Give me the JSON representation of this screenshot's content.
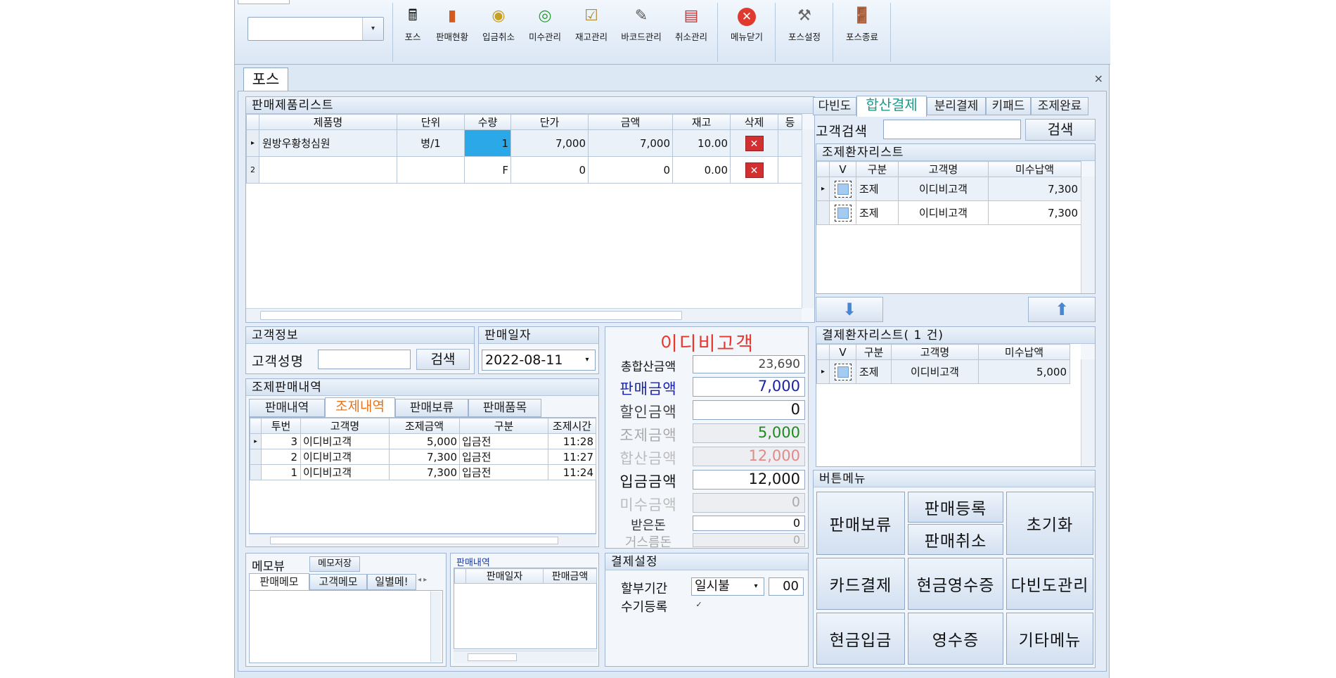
{
  "ribbon": {
    "buttons": [
      {
        "label": "포스",
        "icon": "cash-register-icon"
      },
      {
        "label": "판매현황",
        "icon": "bar-chart-icon"
      },
      {
        "label": "입금취소",
        "icon": "coin-cancel-icon"
      },
      {
        "label": "미수관리",
        "icon": "coins-icon"
      },
      {
        "label": "재고관리",
        "icon": "clipboard-check-icon"
      },
      {
        "label": "바코드관리",
        "icon": "barcode-scanner-icon"
      },
      {
        "label": "취소관리",
        "icon": "cancel-list-icon"
      },
      {
        "label": "메뉴닫기",
        "icon": "close-circle-icon"
      },
      {
        "label": "포스설정",
        "icon": "tools-icon"
      },
      {
        "label": "포스종료",
        "icon": "exit-door-icon"
      }
    ]
  },
  "page_tab": "포스",
  "products": {
    "title": "판매제품리스트",
    "columns": [
      "제품명",
      "단위",
      "수량",
      "단가",
      "금액",
      "재고",
      "삭제",
      "등"
    ],
    "rows": [
      {
        "no": "",
        "name": "원방우황청심원",
        "unit": "병/1",
        "qty": "1",
        "price": "7,000",
        "amount": "7,000",
        "stock": "10.00"
      },
      {
        "no": "2",
        "name": "",
        "unit": "",
        "qty": "F",
        "price": "0",
        "amount": "0",
        "stock": "0.00"
      }
    ]
  },
  "right_tabs": [
    "다빈도",
    "합산결제",
    "분리결제",
    "키패드",
    "조제완료"
  ],
  "customer_search": {
    "label": "고객검색",
    "button": "검색"
  },
  "rx_wait": {
    "title": "조제환자리스트",
    "columns": [
      "V",
      "구분",
      "고객명",
      "미수납액"
    ],
    "rows": [
      {
        "type": "조제",
        "name": "이디비고객",
        "amount": "7,300"
      },
      {
        "type": "조제",
        "name": "이디비고객",
        "amount": "7,300"
      }
    ]
  },
  "pay_list": {
    "title": "결제환자리스트( 1 건)",
    "columns": [
      "V",
      "구분",
      "고객명",
      "미수납액"
    ],
    "rows": [
      {
        "type": "조제",
        "name": "이디비고객",
        "amount": "5,000"
      }
    ]
  },
  "customer_info": {
    "title": "고객정보",
    "name_label": "고객성명",
    "button": "검색"
  },
  "sale_date": {
    "title": "판매일자",
    "value": "2022-08-11"
  },
  "rx_sales": {
    "title": "조제판매내역",
    "tabs": [
      "판매내역",
      "조제내역",
      "판매보류",
      "판매품목"
    ],
    "columns": [
      "투번",
      "고객명",
      "조제금액",
      "구분",
      "조제시간"
    ],
    "rows": [
      {
        "no": "3",
        "name": "이디비고객",
        "amount": "5,000",
        "status": "입금전",
        "time": "11:28"
      },
      {
        "no": "2",
        "name": "이디비고객",
        "amount": "7,300",
        "status": "입금전",
        "time": "11:27"
      },
      {
        "no": "1",
        "name": "이디비고객",
        "amount": "7,300",
        "status": "입금전",
        "time": "11:24"
      }
    ]
  },
  "summary": {
    "customer": "이디비고객",
    "rows": [
      {
        "label": "총합산금액",
        "value": "23,690"
      },
      {
        "label": "판매금액",
        "value": "7,000"
      },
      {
        "label": "할인금액",
        "value": "0"
      },
      {
        "label": "조제금액",
        "value": "5,000"
      },
      {
        "label": "합산금액",
        "value": "12,000"
      },
      {
        "label": "입금금액",
        "value": "12,000"
      },
      {
        "label": "미수금액",
        "value": "0"
      },
      {
        "label": "받은돈",
        "value": "0"
      },
      {
        "label": "거스름돈",
        "value": "0"
      }
    ]
  },
  "memo": {
    "title": "메모뷰",
    "save_button": "메모저장",
    "tabs": [
      "판매메모",
      "고객메모",
      "일별메!"
    ]
  },
  "sales_history": {
    "title": "판매내역",
    "columns": [
      "판매일자",
      "판매금액"
    ]
  },
  "payment_settings": {
    "title": "결제설정",
    "installment_label": "할부기간",
    "installment_value": "일시불",
    "installment_months": "00",
    "manual_label": "수기등록",
    "manual_check": "✓"
  },
  "button_menu": {
    "title": "버튼메뉴",
    "buttons": [
      "판매보류",
      "판매등록",
      "판매취소",
      "초기화",
      "카드결제",
      "현금영수증",
      "다빈도관리",
      "현금입금",
      "영수증",
      "기타메뉴"
    ]
  },
  "colors": {
    "accent_red": "#e8382e",
    "blue_text": "#1a23a8",
    "green_text": "#1f8a1f",
    "pink_text": "#e08a8a",
    "highlight": "#2aa8e8",
    "tab_active_text": "#e8741a"
  }
}
